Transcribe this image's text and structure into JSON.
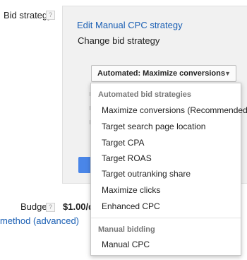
{
  "bid_strategy": {
    "label": "Bid strategy",
    "help": "?",
    "edit_link": "Edit Manual CPC strategy",
    "change_label": "Change bid strategy",
    "selected": "Automated: Maximize conversions",
    "chevron_icon": "chevron-down-icon"
  },
  "dropdown": {
    "groups": [
      {
        "label": "Automated bid strategies",
        "options": [
          "Maximize conversions (Recommended)",
          "Target search page location",
          "Target CPA",
          "Target ROAS",
          "Target outranking share",
          "Maximize clicks",
          "Enhanced CPC"
        ]
      },
      {
        "label": "Manual bidding",
        "options": [
          "Manual CPC"
        ]
      }
    ]
  },
  "budget": {
    "label": "Budget",
    "help": "?",
    "value": "$1.00/da"
  },
  "method_link": "method (advanced)",
  "colors": {
    "link": "#1a5fb4",
    "panel_bg": "#f1f1f1",
    "button_blue": "#4a86e8"
  }
}
